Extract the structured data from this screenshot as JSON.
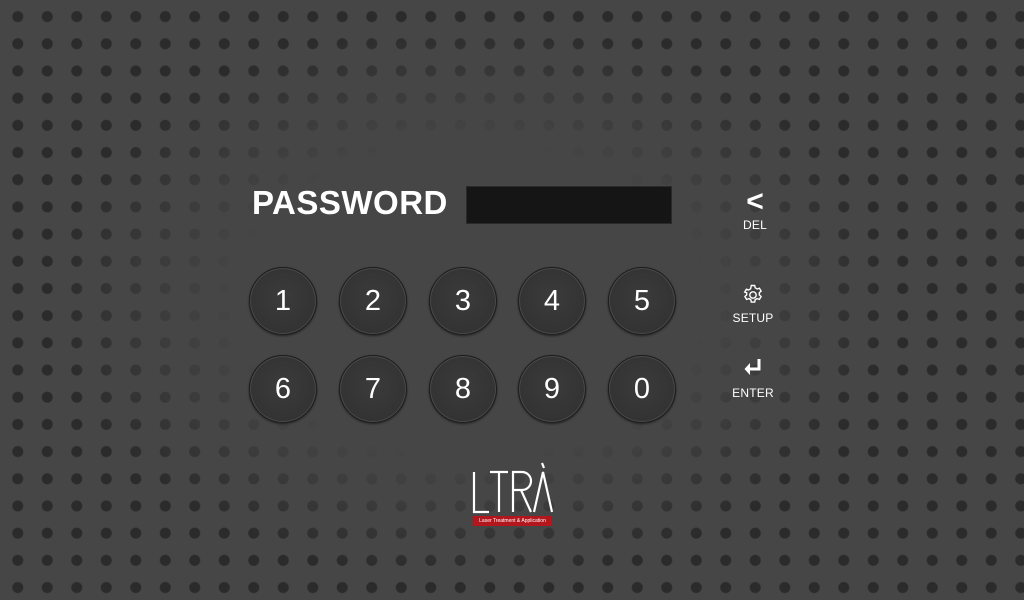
{
  "login": {
    "password_label": "PASSWORD",
    "password_value": ""
  },
  "keypad": {
    "keys": [
      "1",
      "2",
      "3",
      "4",
      "5",
      "6",
      "7",
      "8",
      "9",
      "0"
    ]
  },
  "controls": {
    "del_symbol": "<",
    "del_label": "DEL",
    "setup_label": "SETUP",
    "enter_label": "ENTER"
  },
  "brand": {
    "logo_text": "LTRA",
    "tagline": "Laser Treatment & Application",
    "accent_color": "#b3161d"
  },
  "icons": {
    "delete": "chevron-left-icon",
    "setup": "gear-icon",
    "enter": "return-arrow-icon"
  }
}
